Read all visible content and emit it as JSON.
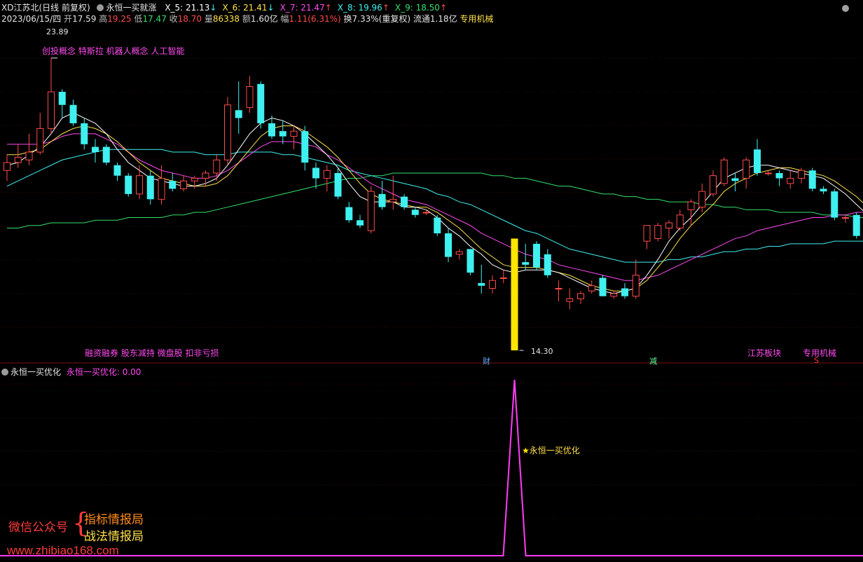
{
  "header": {
    "stock": "XD江苏北(日线 前复权)",
    "indicator_name": "永恒一买就涨",
    "ma": [
      {
        "label": "X_5: 21.13",
        "arrow": "↓",
        "color": "#ffffff",
        "arrow_color": "#3ff0f0"
      },
      {
        "label": "X_6: 21.41",
        "arrow": "↓",
        "color": "#ffe14a",
        "arrow_color": "#3ff0f0"
      },
      {
        "label": "X_7: 21.47",
        "arrow": "↑",
        "color": "#ff4af0",
        "arrow_color": "#ff4a4a"
      },
      {
        "label": "X_8: 19.96",
        "arrow": "↑",
        "color": "#3ff0f0",
        "arrow_color": "#ff4a4a"
      },
      {
        "label": "X_9: 18.50",
        "arrow": "↑",
        "color": "#33e06b",
        "arrow_color": "#ff4a4a"
      }
    ]
  },
  "quote": {
    "date": "2023/06/15/四",
    "open_label": "开",
    "open": "17.59",
    "high_label": "高",
    "high": "19.25",
    "low_label": "低",
    "low": "17.47",
    "close_label": "收",
    "close": "18.70",
    "vol_label": "量",
    "vol": "86338",
    "amount_label": "额",
    "amount": "1.60亿",
    "chg_label": "幅",
    "chg": "1.11(6.31%)",
    "turnover": "换7.33%(重复权)",
    "float": "流通1.18亿",
    "industry": "专用机械"
  },
  "price_labels": {
    "high": "23.89",
    "low": "14.30"
  },
  "concepts_top": "创投概念 特斯拉 机器人概念 人工智能",
  "concepts_bottom": "融资融券 股东减持 微盘股 扣非亏损",
  "markers": {
    "cai": "财",
    "jian": "减",
    "jiangsu": "江苏板块",
    "industry": "专用机械",
    "s": "S"
  },
  "sub": {
    "title": "永恒一买优化",
    "value_label": "永恒一买优化: 0.00",
    "signal_label": "永恒一买优化",
    "star": "★"
  },
  "watermark": {
    "left": "微信公众号",
    "brace": "{",
    "line1": "指标情报局",
    "line2": "战法情报局",
    "url": "www.zhibiao168.com"
  },
  "colors": {
    "up": "#ff4a4a",
    "down": "#3ff0f0",
    "signal": "#ffe600",
    "sub_line": "#ff3cf5"
  },
  "chart_data": {
    "type": "candlestick",
    "ohlc": [
      [
        19.6,
        20.2,
        19.2,
        19.9
      ],
      [
        19.9,
        20.6,
        19.7,
        20.1
      ],
      [
        20.0,
        21.0,
        19.8,
        20.3
      ],
      [
        20.3,
        21.8,
        20.2,
        21.2
      ],
      [
        21.2,
        23.89,
        21.0,
        22.6
      ],
      [
        22.6,
        22.7,
        21.6,
        22.1
      ],
      [
        22.1,
        22.3,
        21.3,
        21.4
      ],
      [
        21.4,
        21.6,
        20.4,
        20.6
      ],
      [
        20.5,
        20.8,
        19.9,
        20.3
      ],
      [
        20.5,
        20.6,
        19.8,
        19.9
      ],
      [
        19.8,
        19.9,
        19.2,
        19.4
      ],
      [
        19.4,
        19.5,
        18.6,
        18.7
      ],
      [
        18.7,
        19.8,
        18.5,
        19.4
      ],
      [
        19.4,
        19.6,
        18.3,
        18.5
      ],
      [
        18.5,
        19.8,
        18.3,
        19.3
      ],
      [
        19.2,
        19.5,
        18.8,
        18.9
      ],
      [
        18.9,
        19.4,
        18.8,
        19.2
      ],
      [
        19.2,
        19.4,
        18.9,
        19.3
      ],
      [
        19.3,
        19.6,
        19.0,
        19.5
      ],
      [
        19.5,
        20.2,
        19.2,
        20.0
      ],
      [
        20.0,
        22.4,
        19.8,
        22.1
      ],
      [
        21.9,
        23.0,
        21.0,
        21.6
      ],
      [
        22.0,
        23.2,
        21.8,
        22.8
      ],
      [
        22.9,
        23.0,
        21.2,
        21.4
      ],
      [
        21.4,
        21.7,
        20.8,
        20.9
      ],
      [
        21.1,
        21.5,
        20.6,
        20.9
      ],
      [
        20.9,
        21.3,
        20.4,
        21.1
      ],
      [
        21.1,
        21.3,
        19.6,
        19.9
      ],
      [
        19.7,
        19.9,
        18.9,
        19.3
      ],
      [
        19.3,
        19.8,
        18.8,
        19.6
      ],
      [
        19.5,
        19.7,
        18.5,
        18.6
      ],
      [
        18.2,
        18.4,
        17.6,
        17.7
      ],
      [
        17.7,
        17.9,
        17.4,
        17.5
      ],
      [
        17.3,
        19.0,
        17.2,
        18.8
      ],
      [
        18.7,
        19.2,
        18.1,
        18.2
      ],
      [
        18.4,
        19.4,
        18.1,
        18.5
      ],
      [
        18.6,
        18.7,
        18.1,
        18.2
      ],
      [
        18.1,
        18.2,
        17.8,
        17.9
      ],
      [
        18.0,
        18.1,
        17.9,
        18.0
      ],
      [
        17.8,
        17.9,
        17.1,
        17.2
      ],
      [
        17.2,
        17.4,
        16.1,
        16.3
      ],
      [
        16.4,
        16.6,
        16.2,
        16.5
      ],
      [
        16.6,
        16.6,
        15.6,
        15.7
      ],
      [
        15.3,
        16.0,
        14.9,
        15.2
      ],
      [
        15.1,
        15.6,
        14.9,
        15.4
      ],
      [
        15.5,
        15.8,
        15.3,
        15.5
      ],
      [
        15.6,
        16.5,
        15.5,
        16.4
      ],
      [
        16.1,
        16.8,
        15.8,
        16.0
      ],
      [
        16.8,
        16.9,
        15.8,
        15.9
      ],
      [
        16.4,
        16.6,
        15.5,
        15.6
      ],
      [
        15.1,
        15.4,
        14.6,
        15.1
      ],
      [
        14.6,
        15.1,
        14.3,
        14.7
      ],
      [
        14.7,
        15.0,
        14.5,
        14.9
      ],
      [
        15.0,
        15.4,
        14.9,
        15.2
      ],
      [
        15.5,
        15.6,
        14.8,
        14.8
      ],
      [
        14.8,
        15.0,
        14.7,
        14.9
      ],
      [
        15.1,
        15.3,
        14.7,
        14.8
      ],
      [
        14.8,
        16.2,
        14.7,
        15.6
      ],
      [
        16.9,
        17.4,
        16.6,
        17.5
      ],
      [
        17.0,
        17.6,
        16.9,
        17.5
      ],
      [
        17.4,
        17.7,
        17.0,
        17.6
      ],
      [
        17.4,
        18.1,
        17.3,
        17.9
      ],
      [
        18.1,
        18.5,
        17.5,
        18.4
      ],
      [
        18.2,
        19.1,
        18.0,
        18.8
      ],
      [
        18.7,
        19.6,
        18.6,
        19.4
      ],
      [
        19.1,
        20.1,
        19.0,
        20.0
      ],
      [
        19.3,
        19.5,
        18.8,
        19.2
      ],
      [
        19.3,
        20.1,
        18.9,
        20.0
      ],
      [
        20.4,
        20.8,
        19.4,
        19.5
      ],
      [
        19.5,
        19.6,
        19.4,
        19.5
      ],
      [
        19.5,
        19.6,
        19.0,
        19.3
      ],
      [
        19.1,
        19.6,
        18.9,
        19.3
      ],
      [
        19.3,
        19.7,
        19.1,
        19.6
      ],
      [
        19.6,
        19.7,
        18.8,
        18.9
      ],
      [
        18.9,
        19.0,
        18.7,
        18.8
      ],
      [
        18.8,
        18.9,
        17.7,
        17.8
      ],
      [
        17.8,
        17.9,
        17.6,
        17.8
      ],
      [
        17.9,
        18.0,
        17.0,
        17.1
      ],
      [
        17.1,
        17.3,
        16.7,
        16.9
      ],
      [
        16.6,
        17.3,
        16.5,
        17.1
      ],
      [
        17.1,
        17.2,
        17.0,
        17.1
      ],
      [
        17.2,
        17.4,
        16.6,
        17.2
      ],
      [
        17.59,
        19.25,
        17.47,
        18.7
      ]
    ],
    "ma5": [
      19.8,
      19.9,
      20.2,
      20.5,
      21.0,
      21.6,
      21.8,
      21.6,
      21.4,
      21.0,
      20.4,
      19.9,
      19.6,
      19.3,
      19.2,
      19.1,
      19.0,
      19.0,
      19.1,
      19.3,
      19.8,
      20.4,
      21.0,
      21.4,
      21.6,
      21.5,
      21.3,
      21.0,
      20.6,
      20.2,
      19.7,
      19.1,
      18.6,
      18.4,
      18.4,
      18.4,
      18.2,
      18.2,
      18.1,
      17.8,
      17.4,
      17.1,
      16.7,
      16.4,
      16.0,
      15.8,
      15.7,
      15.8,
      15.8,
      15.8,
      15.7,
      15.5,
      15.3,
      15.1,
      15.0,
      14.9,
      15.0,
      15.1,
      15.6,
      16.2,
      16.9,
      17.4,
      17.8,
      18.3,
      18.8,
      19.3,
      19.5,
      19.7,
      19.8,
      19.8,
      19.7,
      19.6,
      19.5,
      19.4,
      19.3,
      19.0,
      18.7,
      18.3,
      17.9,
      17.5,
      17.3,
      17.1,
      17.4
    ],
    "ma6": [
      20.2,
      20.2,
      20.3,
      20.4,
      20.7,
      21.0,
      21.2,
      21.3,
      21.2,
      21.0,
      20.7,
      20.3,
      19.9,
      19.6,
      19.3,
      19.2,
      19.1,
      19.0,
      19.0,
      19.1,
      19.4,
      19.9,
      20.4,
      20.9,
      21.2,
      21.3,
      21.3,
      21.1,
      20.8,
      20.5,
      20.1,
      19.6,
      19.1,
      18.7,
      18.5,
      18.4,
      18.3,
      18.2,
      18.2,
      18.0,
      17.7,
      17.4,
      17.0,
      16.6,
      16.3,
      16.0,
      15.9,
      15.9,
      15.9,
      15.8,
      15.7,
      15.6,
      15.4,
      15.2,
      15.1,
      15.0,
      15.0,
      15.1,
      15.4,
      15.9,
      16.4,
      17.0,
      17.5,
      17.9,
      18.3,
      18.8,
      19.1,
      19.3,
      19.5,
      19.6,
      19.7,
      19.7,
      19.6,
      19.5,
      19.4,
      19.2,
      18.9,
      18.6,
      18.2,
      17.8,
      17.5,
      17.3,
      17.3
    ],
    "ma7": [
      20.6,
      20.6,
      20.6,
      20.6,
      20.7,
      20.9,
      21.0,
      21.0,
      21.0,
      20.8,
      20.6,
      20.3,
      20.0,
      19.8,
      19.6,
      19.5,
      19.4,
      19.3,
      19.3,
      19.4,
      19.6,
      19.9,
      20.2,
      20.5,
      20.7,
      20.7,
      20.7,
      20.6,
      20.5,
      20.2,
      20.0,
      19.7,
      19.4,
      19.1,
      18.9,
      18.7,
      18.5,
      18.4,
      18.3,
      18.1,
      17.9,
      17.7,
      17.5,
      17.2,
      17.0,
      16.8,
      16.6,
      16.4,
      16.3,
      16.2,
      16.0,
      15.9,
      15.8,
      15.7,
      15.6,
      15.5,
      15.4,
      15.4,
      15.5,
      15.6,
      15.8,
      16.0,
      16.2,
      16.4,
      16.6,
      16.8,
      17.0,
      17.1,
      17.3,
      17.4,
      17.5,
      17.6,
      17.7,
      17.8,
      17.8,
      17.9,
      17.9,
      18.0,
      18.0,
      18.1,
      18.1,
      18.1,
      18.2
    ],
    "ma8": [
      19.0,
      19.2,
      19.4,
      19.6,
      19.8,
      20.0,
      20.1,
      20.2,
      20.3,
      20.4,
      20.4,
      20.4,
      20.4,
      20.4,
      20.4,
      20.3,
      20.3,
      20.3,
      20.2,
      20.2,
      20.2,
      20.3,
      20.3,
      20.3,
      20.3,
      20.2,
      20.2,
      20.1,
      20.0,
      19.9,
      19.8,
      19.6,
      19.5,
      19.4,
      19.3,
      19.2,
      19.1,
      19.0,
      18.9,
      18.7,
      18.6,
      18.4,
      18.3,
      18.1,
      17.9,
      17.7,
      17.5,
      17.3,
      17.2,
      17.0,
      16.8,
      16.6,
      16.5,
      16.4,
      16.3,
      16.2,
      16.1,
      16.1,
      16.1,
      16.1,
      16.2,
      16.2,
      16.3,
      16.3,
      16.4,
      16.5,
      16.5,
      16.6,
      16.6,
      16.7,
      16.7,
      16.8,
      16.8,
      16.8,
      16.8,
      16.9,
      16.9,
      16.9,
      16.9,
      17.0,
      17.0,
      17.0,
      17.0
    ],
    "ma9": [
      17.4,
      17.4,
      17.5,
      17.5,
      17.6,
      17.6,
      17.6,
      17.6,
      17.7,
      17.7,
      17.7,
      17.8,
      17.8,
      17.8,
      17.8,
      17.9,
      17.9,
      18.0,
      18.0,
      18.1,
      18.2,
      18.3,
      18.4,
      18.5,
      18.6,
      18.7,
      18.8,
      18.9,
      19.0,
      19.1,
      19.2,
      19.3,
      19.3,
      19.4,
      19.4,
      19.5,
      19.5,
      19.5,
      19.5,
      19.5,
      19.5,
      19.5,
      19.5,
      19.5,
      19.4,
      19.4,
      19.3,
      19.3,
      19.2,
      19.1,
      19.0,
      19.0,
      18.9,
      18.8,
      18.7,
      18.7,
      18.6,
      18.6,
      18.5,
      18.5,
      18.4,
      18.4,
      18.4,
      18.3,
      18.3,
      18.2,
      18.2,
      18.1,
      18.1,
      18.1,
      18.0,
      18.0,
      18.0,
      18.0,
      17.9,
      17.9,
      17.9,
      17.8,
      17.8,
      17.8,
      17.7,
      17.7,
      17.7
    ],
    "signal_index": 46,
    "ylim": [
      13.0,
      24.5
    ],
    "sub_ylim": [
      0,
      1
    ]
  }
}
